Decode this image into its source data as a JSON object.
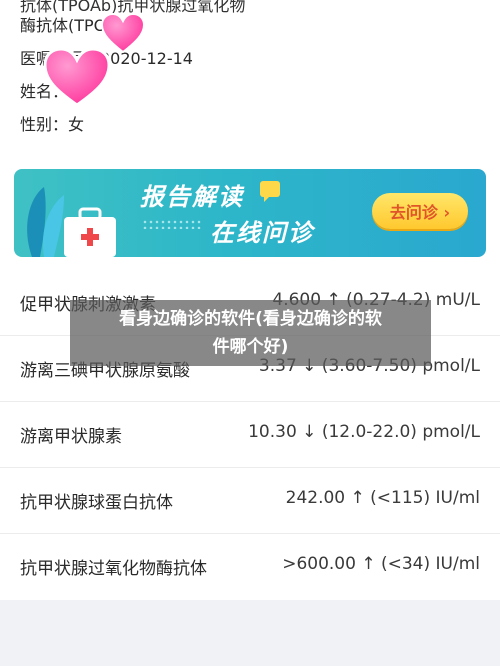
{
  "patient_info": {
    "cut_line": "抗体(TPOAb)抗甲状腺过氧化物",
    "line1": "酶抗体(TPOAb)",
    "line2": "医嘱时间：2020-12-14",
    "line3": "姓名：",
    "line4": "性别：女"
  },
  "banner": {
    "title": "报告解读",
    "subtitle": "在线问诊",
    "button": "去问诊 ›"
  },
  "results": [
    {
      "name": "促甲状腺刺激激素",
      "value": "4.600 ↑ (0.27-4.2) mU/L"
    },
    {
      "name": "游离三碘甲状腺原氨酸",
      "value": "3.37 ↓ (3.60-7.50) pmol/L"
    },
    {
      "name": "游离甲状腺素",
      "value": "10.30 ↓ (12.0-22.0) pmol/L"
    },
    {
      "name": "抗甲状腺球蛋白抗体",
      "value": "242.00 ↑ (<115) IU/ml"
    },
    {
      "name": "抗甲状腺过氧化物酶抗体",
      "value": ">600.00 ↑ (<34) IU/ml"
    }
  ],
  "overlay": {
    "line1": "看身边确诊的软件(看身边确诊的软",
    "line2": "件哪个好)"
  },
  "colors": {
    "banner": "#2db6c9",
    "button": "#ffc82e",
    "heart": "#ff4fa8"
  }
}
